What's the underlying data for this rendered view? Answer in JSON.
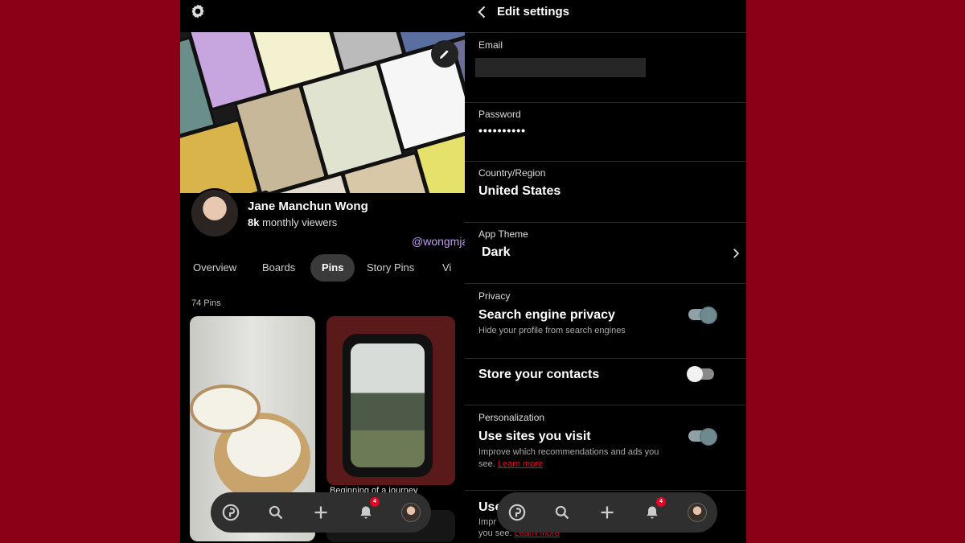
{
  "profile": {
    "name": "Jane Manchun Wong",
    "viewers_count": "8k",
    "viewers_label": "monthly viewers",
    "watermark": "@wongmjane",
    "tabs": [
      "Overview",
      "Boards",
      "Pins",
      "Story Pins",
      "Vi"
    ],
    "active_tab": "Pins",
    "pin_count": "74 Pins",
    "pins": [
      {
        "caption": ""
      },
      {
        "caption": "Beginning of a journey"
      }
    ]
  },
  "bottom_nav": {
    "items": [
      "home-icon",
      "search-icon",
      "plus-icon",
      "bell-icon",
      "avatar"
    ],
    "notification_badge": "4"
  },
  "settings": {
    "title": "Edit settings",
    "email": {
      "label": "Email",
      "value": ""
    },
    "password": {
      "label": "Password",
      "value": "••••••••••"
    },
    "country": {
      "label": "Country/Region",
      "value": "United States"
    },
    "theme": {
      "label": "App Theme",
      "value": "Dark"
    },
    "privacy": {
      "label": "Privacy",
      "title": "Search engine privacy",
      "desc": "Hide your profile from search engines",
      "enabled": true
    },
    "contacts": {
      "title": "Store your contacts",
      "enabled": false
    },
    "personalization": {
      "label": "Personalization",
      "title": "Use sites you visit",
      "desc": "Improve which recommendations and ads you see.",
      "link": "Learn more",
      "enabled": true
    },
    "partial_row": {
      "title": "Use",
      "desc": "Impr",
      "desc2": "you see.",
      "link": "Learn more"
    }
  },
  "colors": {
    "accent": "#e60023",
    "background": "#8a0016",
    "panel": "#000000",
    "nav": "#2f2f2f"
  }
}
